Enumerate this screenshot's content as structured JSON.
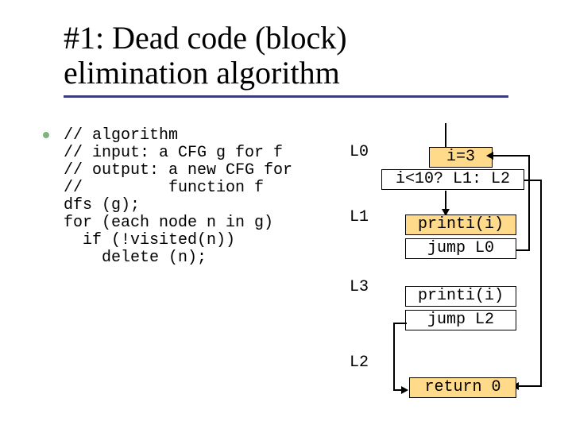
{
  "title_line1": "#1: Dead code (block)",
  "title_line2": "elimination algorithm",
  "code": "// algorithm\n// input: a CFG g for f\n// output: a new CFG for\n//         function f\ndfs (g);\nfor (each node n in g)\n  if (!visited(n))\n    delete (n);",
  "labels": {
    "L0": "L0",
    "L1": "L1",
    "L3": "L3",
    "L2": "L2"
  },
  "blocks": {
    "b0a": "i=3",
    "b0b": "i<10? L1: L2",
    "b1a": "printi(i)",
    "b1b": "jump L0",
    "b3a": "printi(i)",
    "b3b": "jump L2",
    "b2": "return 0"
  }
}
